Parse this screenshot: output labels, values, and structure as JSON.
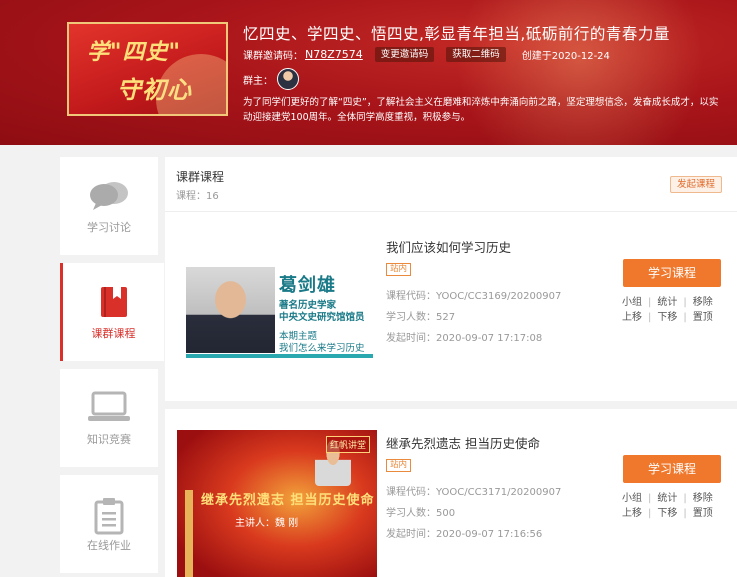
{
  "header": {
    "title": "忆四史、学四史、悟四史,彰显青年担当,砥砺前行的青春力量",
    "cover_line1": "学\"四史\"",
    "cover_line2": "守初心",
    "invite_label": "课群邀请码：",
    "invite_code": "N78Z7574",
    "change_invite": "变更邀请码",
    "get_qr": "获取二维码",
    "created": "创建于2020-12-24",
    "owner_label": "群主：",
    "description_line1": "为了同学们更好的了解“四史”，了解社会主义在磨难和淬炼中奔涌向前之路，坚定理想信念，发奋成长成才，以实",
    "description_line2": "动迎接建党100周年。全体同学高度重视，积极参与。"
  },
  "sidebar": {
    "items": [
      {
        "label": "学习讨论",
        "icon": "chat-bubbles-icon",
        "active": false
      },
      {
        "label": "课群课程",
        "icon": "book-icon",
        "active": true
      },
      {
        "label": "知识竞赛",
        "icon": "laptop-icon",
        "active": false
      },
      {
        "label": "在线作业",
        "icon": "clipboard-icon",
        "active": false
      }
    ]
  },
  "panel": {
    "title": "课群课程",
    "count": "课程：16",
    "launch_button": "发起课程"
  },
  "courses": [
    {
      "name": "我们应该如何学习历史",
      "tag": "站内",
      "code": "课程代码：YOOC/CC3169/20200907",
      "learners": "学习人数：527",
      "published": "发起时间：2020-09-07 17:17:08",
      "study_button": "学习课程",
      "thumb_name": "葛剑雄",
      "thumb_sub1": "著名历史学家",
      "thumb_sub2": "中央文史研究馆馆员",
      "thumb_sub3": "本期主题",
      "thumb_sub4": "我们怎么来学习历史",
      "actions": [
        "小组",
        "统计",
        "移除",
        "上移",
        "下移",
        "置顶"
      ]
    },
    {
      "name": "继承先烈遗志 担当历史使命",
      "tag": "站内",
      "code": "课程代码：YOOC/CC3171/20200907",
      "learners": "学习人数：500",
      "published": "发起时间：2020-09-07 17:16:56",
      "study_button": "学习课程",
      "thumb_badge": "红帆讲堂",
      "thumb_headline": "继承先烈遗志 担当历史使命",
      "thumb_speaker": "主讲人：魏 刚",
      "actions": [
        "小组",
        "统计",
        "移除",
        "上移",
        "下移",
        "置顶"
      ]
    }
  ],
  "colors": {
    "accent": "#d9302a",
    "study_button": "#f0782c",
    "banner": "#a9151a"
  }
}
